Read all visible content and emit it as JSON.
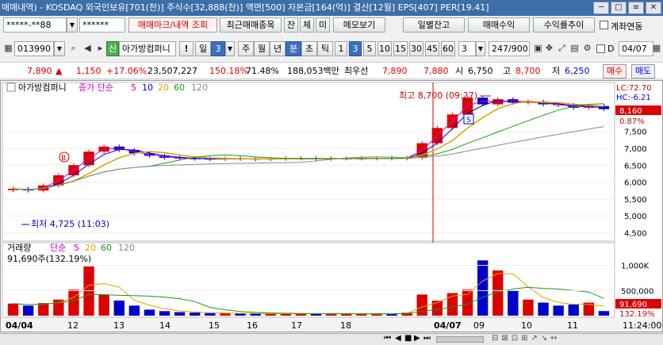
{
  "title": {
    "text": "매매내역) - KOSDAQ 외국인보유[701(천)] 주식수[32,888(천)] 액면[500] 자본금[164(억)] 결산[12월] EPS[407] PER[19.41]",
    "buttons": [
      "─",
      "□",
      "≡",
      "✕"
    ]
  },
  "toolbar1": {
    "account_value": "*****-**88",
    "password_value": "******",
    "btn_margin_mark": "매매마크/내역 조회",
    "btn_recent": "최근매매종목",
    "btn_jan": "잔",
    "btn_che": "체",
    "btn_mi": "미",
    "btn_memo": "메모보기",
    "btn_daily": "일별잔고",
    "btn_profit": "매매수익",
    "btn_return": "수익률추이",
    "checkbox_label": "계좌연동"
  },
  "toolbar2": {
    "code_value": "013990",
    "stock_name": "아가방컴퍼니",
    "icon_sin": "신",
    "icon_warn": "!",
    "period_il": "일",
    "period_num": "3",
    "period_ju": "주",
    "period_wol": "월",
    "period_nyeon": "년",
    "period_bun": "분",
    "period_cho": "초",
    "period_tik": "틱",
    "intervals": [
      "1",
      "3",
      "5",
      "10",
      "15",
      "30",
      "45",
      "60"
    ],
    "interval_input": "3",
    "count_value": "247/900",
    "check_d": "D",
    "date_value": "04/07"
  },
  "quote": {
    "price": "7,890",
    "arrow": "▲",
    "change": "1,150",
    "change_pct": "+17.06%",
    "volume": "23,507,227",
    "vol_ratio": "150.18%",
    "turnover": "71.48%",
    "amount": "188,053백만",
    "best_label": "최우선",
    "best_ask": "7,890",
    "best_bid": "7,880",
    "open_label": "시",
    "open": "6,750",
    "high_label": "고",
    "high": "8,700",
    "low_label": "저",
    "low": "6,250",
    "buy_btn": "매수",
    "sell_btn": "매도"
  },
  "price_chart": {
    "stock_label": "아가방컴퍼니",
    "ma_type": "종가 단순",
    "ma_periods": [
      "5",
      "10",
      "20",
      "60",
      "120"
    ],
    "lc_label": "LC:72.70",
    "hc_label": "HC:-6.21",
    "current_price_tag": "8,160",
    "current_pct_tag": "0.87%",
    "max_annotation": "최고 8,700 (09:27)",
    "min_annotation": "최저 4,725 (11:03)",
    "marker_b": "B",
    "marker_s": "S"
  },
  "volume_chart": {
    "label": "거래량",
    "ma_type": "단순",
    "ma_periods": [
      "5",
      "20",
      "60",
      "120"
    ],
    "info": "91,690주(132.19%)",
    "vol_tag": "91,690",
    "vol_pct_tag": "132.19%"
  },
  "x_axis": {
    "labels": [
      "04/04",
      "12",
      "13",
      "14",
      "15",
      "16",
      "17",
      "18",
      "04/07",
      "09",
      "10",
      "11"
    ],
    "time_label": "11:24:00"
  },
  "chart_data": {
    "type": "candlestick",
    "price_axis": [
      "7,500",
      "7,000",
      "6,500",
      "6,000",
      "5,500",
      "5,000",
      "4,500"
    ],
    "price_ylim": [
      4300,
      8900
    ],
    "volume_axis": [
      "1,000K",
      "500,000"
    ],
    "volume_ylim": [
      0,
      1200000
    ],
    "max_price": 8700,
    "min_price": 4725,
    "last_price": 8160,
    "price_series_close": [
      5800,
      5750,
      5900,
      6200,
      6500,
      6900,
      7050,
      6950,
      6850,
      6780,
      6720,
      6700,
      6690,
      6680,
      6700,
      6690,
      6680,
      6690,
      6700,
      6700,
      6690,
      6700,
      6700,
      6700,
      6710,
      6700,
      6720,
      7150,
      7600,
      8000,
      8500,
      8300,
      8450,
      8350,
      8380,
      8300,
      8280,
      8200,
      8250,
      8160
    ],
    "volume_bars": [
      240000,
      200000,
      250000,
      320000,
      520000,
      980000,
      420000,
      300000,
      200000,
      120000,
      90000,
      70000,
      60000,
      50000,
      45000,
      40000,
      42000,
      38000,
      40000,
      36000,
      38000,
      40000,
      35000,
      34000,
      36000,
      40000,
      60000,
      420000,
      300000,
      450000,
      520000,
      1100000,
      900000,
      500000,
      320000,
      260000,
      200000,
      220000,
      260000,
      91690
    ]
  }
}
